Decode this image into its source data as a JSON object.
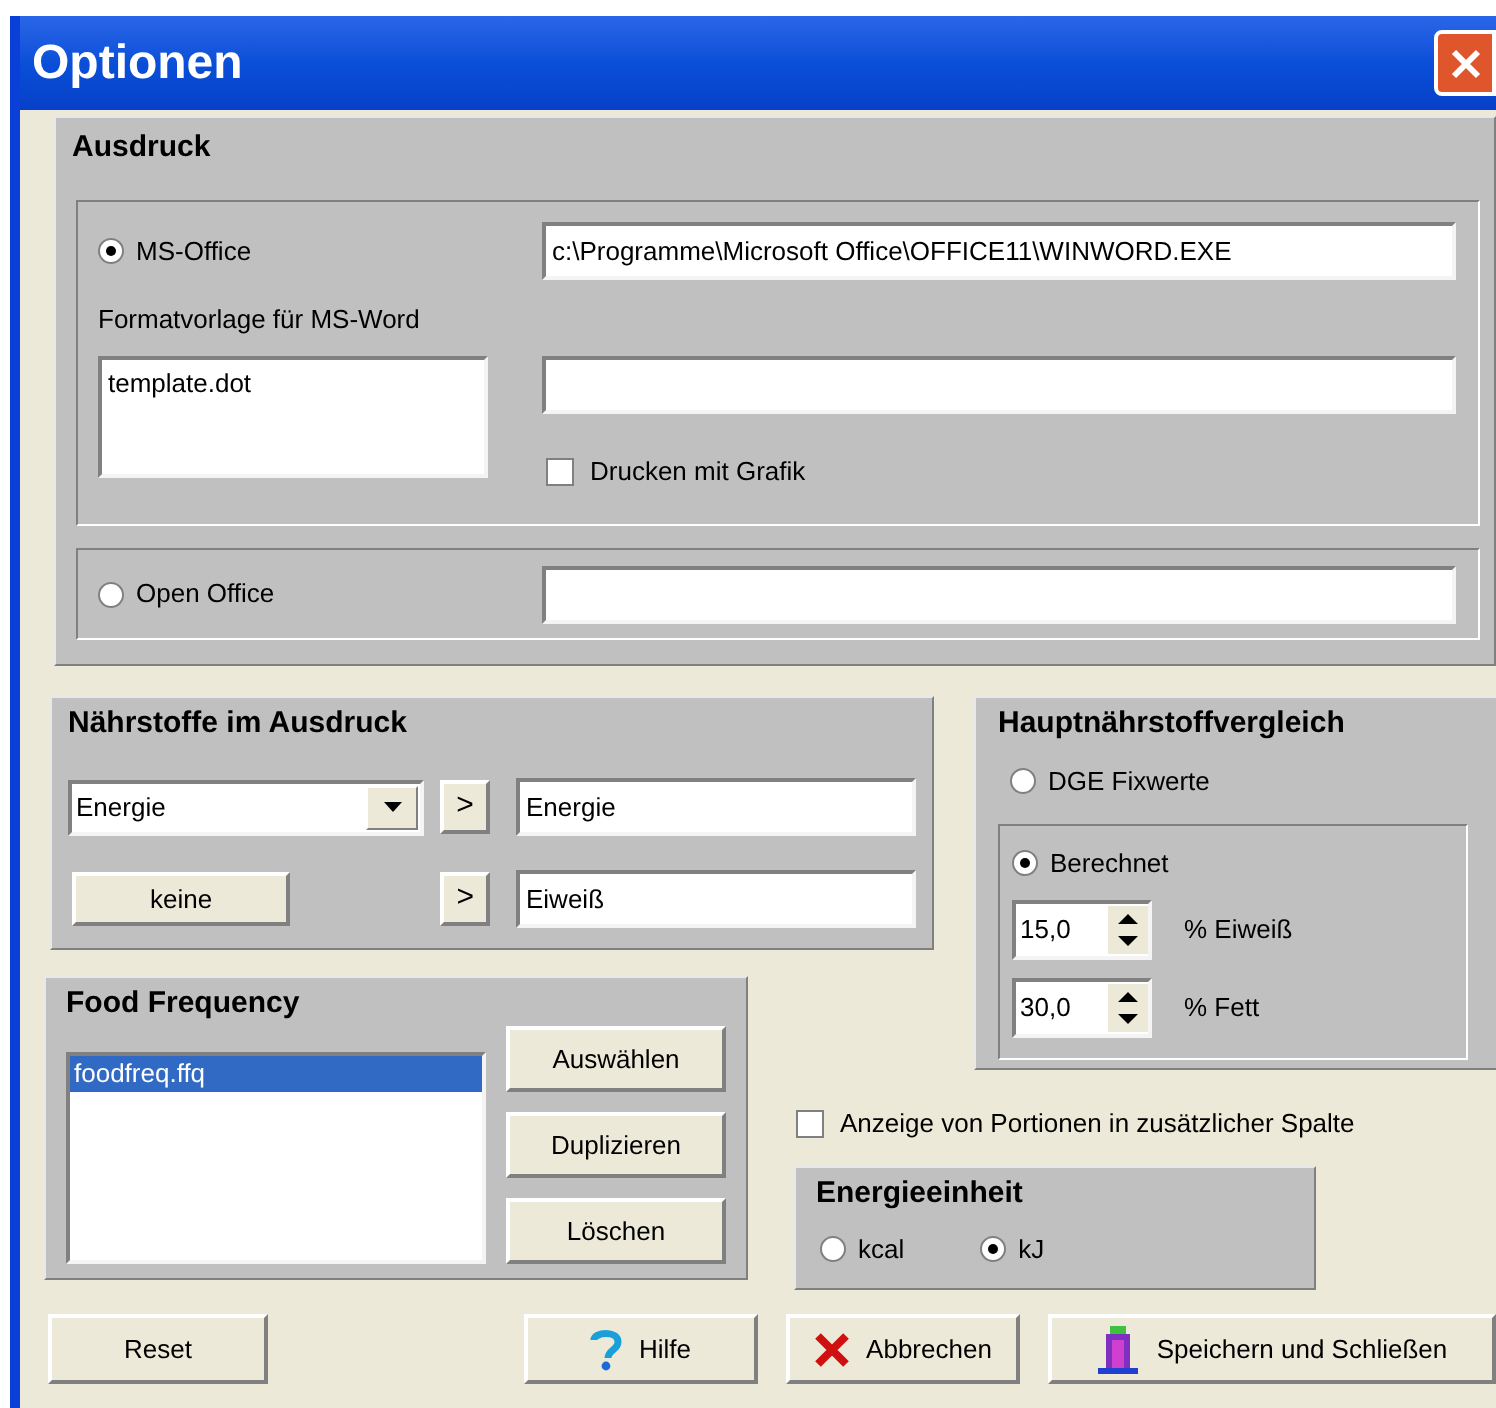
{
  "window": {
    "title": "Optionen"
  },
  "ausdruck": {
    "title": "Ausdruck",
    "ms_office": {
      "label": "MS-Office",
      "selected": true,
      "path": "c:\\Programme\\Microsoft Office\\OFFICE11\\WINWORD.EXE",
      "template_label": "Formatvorlage für MS-Word",
      "templates": [
        "template.dot"
      ],
      "print_graphics": {
        "label": "Drucken mit Grafik",
        "checked": false
      }
    },
    "open_office": {
      "label": "Open Office",
      "selected": false
    }
  },
  "naehrstoffe": {
    "title": "Nährstoffe im Ausdruck",
    "combo_value": "Energie",
    "none_button": "keine",
    "rows": [
      {
        "arrow": ">",
        "value": "Energie"
      },
      {
        "arrow": ">",
        "value": "Eiweiß"
      }
    ]
  },
  "hauptvergleich": {
    "title": "Hauptnährstoffvergleich",
    "options": [
      {
        "label": "DGE Fixwerte",
        "selected": false
      },
      {
        "label": "Berechnet",
        "selected": true
      }
    ],
    "spinners": [
      {
        "value": "15,0",
        "label": "% Eiweiß"
      },
      {
        "value": "30,0",
        "label": "% Fett"
      }
    ]
  },
  "food_frequency": {
    "title": "Food Frequency",
    "files": [
      {
        "name": "foodfreq.ffq",
        "selected": true
      }
    ],
    "buttons": [
      "Auswählen",
      "Duplizieren",
      "Löschen"
    ]
  },
  "portion_column": {
    "label": "Anzeige von Portionen in zusätzlicher Spalte",
    "checked": false
  },
  "energieeinheit": {
    "title": "Energieeinheit",
    "options": [
      {
        "label": "kcal",
        "selected": false
      },
      {
        "label": "kJ",
        "selected": true
      }
    ]
  },
  "buttons": [
    {
      "label": "Reset",
      "kind": "plain"
    },
    {
      "label": "Hilfe",
      "kind": "help"
    },
    {
      "label": "Abbrechen",
      "kind": "cancel"
    },
    {
      "label": "Speichern und Schließen",
      "kind": "save"
    }
  ]
}
